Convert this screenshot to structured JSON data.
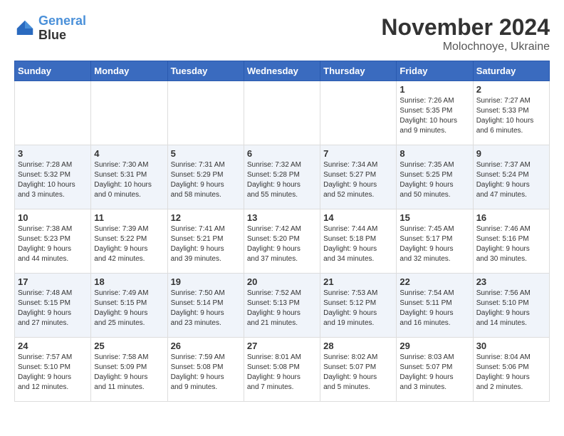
{
  "header": {
    "logo_line1": "General",
    "logo_line2": "Blue",
    "month": "November 2024",
    "location": "Molochnoye, Ukraine"
  },
  "weekdays": [
    "Sunday",
    "Monday",
    "Tuesday",
    "Wednesday",
    "Thursday",
    "Friday",
    "Saturday"
  ],
  "weeks": [
    [
      {
        "day": "",
        "info": ""
      },
      {
        "day": "",
        "info": ""
      },
      {
        "day": "",
        "info": ""
      },
      {
        "day": "",
        "info": ""
      },
      {
        "day": "",
        "info": ""
      },
      {
        "day": "1",
        "info": "Sunrise: 7:26 AM\nSunset: 5:35 PM\nDaylight: 10 hours\nand 9 minutes."
      },
      {
        "day": "2",
        "info": "Sunrise: 7:27 AM\nSunset: 5:33 PM\nDaylight: 10 hours\nand 6 minutes."
      }
    ],
    [
      {
        "day": "3",
        "info": "Sunrise: 7:28 AM\nSunset: 5:32 PM\nDaylight: 10 hours\nand 3 minutes."
      },
      {
        "day": "4",
        "info": "Sunrise: 7:30 AM\nSunset: 5:31 PM\nDaylight: 10 hours\nand 0 minutes."
      },
      {
        "day": "5",
        "info": "Sunrise: 7:31 AM\nSunset: 5:29 PM\nDaylight: 9 hours\nand 58 minutes."
      },
      {
        "day": "6",
        "info": "Sunrise: 7:32 AM\nSunset: 5:28 PM\nDaylight: 9 hours\nand 55 minutes."
      },
      {
        "day": "7",
        "info": "Sunrise: 7:34 AM\nSunset: 5:27 PM\nDaylight: 9 hours\nand 52 minutes."
      },
      {
        "day": "8",
        "info": "Sunrise: 7:35 AM\nSunset: 5:25 PM\nDaylight: 9 hours\nand 50 minutes."
      },
      {
        "day": "9",
        "info": "Sunrise: 7:37 AM\nSunset: 5:24 PM\nDaylight: 9 hours\nand 47 minutes."
      }
    ],
    [
      {
        "day": "10",
        "info": "Sunrise: 7:38 AM\nSunset: 5:23 PM\nDaylight: 9 hours\nand 44 minutes."
      },
      {
        "day": "11",
        "info": "Sunrise: 7:39 AM\nSunset: 5:22 PM\nDaylight: 9 hours\nand 42 minutes."
      },
      {
        "day": "12",
        "info": "Sunrise: 7:41 AM\nSunset: 5:21 PM\nDaylight: 9 hours\nand 39 minutes."
      },
      {
        "day": "13",
        "info": "Sunrise: 7:42 AM\nSunset: 5:20 PM\nDaylight: 9 hours\nand 37 minutes."
      },
      {
        "day": "14",
        "info": "Sunrise: 7:44 AM\nSunset: 5:18 PM\nDaylight: 9 hours\nand 34 minutes."
      },
      {
        "day": "15",
        "info": "Sunrise: 7:45 AM\nSunset: 5:17 PM\nDaylight: 9 hours\nand 32 minutes."
      },
      {
        "day": "16",
        "info": "Sunrise: 7:46 AM\nSunset: 5:16 PM\nDaylight: 9 hours\nand 30 minutes."
      }
    ],
    [
      {
        "day": "17",
        "info": "Sunrise: 7:48 AM\nSunset: 5:15 PM\nDaylight: 9 hours\nand 27 minutes."
      },
      {
        "day": "18",
        "info": "Sunrise: 7:49 AM\nSunset: 5:15 PM\nDaylight: 9 hours\nand 25 minutes."
      },
      {
        "day": "19",
        "info": "Sunrise: 7:50 AM\nSunset: 5:14 PM\nDaylight: 9 hours\nand 23 minutes."
      },
      {
        "day": "20",
        "info": "Sunrise: 7:52 AM\nSunset: 5:13 PM\nDaylight: 9 hours\nand 21 minutes."
      },
      {
        "day": "21",
        "info": "Sunrise: 7:53 AM\nSunset: 5:12 PM\nDaylight: 9 hours\nand 19 minutes."
      },
      {
        "day": "22",
        "info": "Sunrise: 7:54 AM\nSunset: 5:11 PM\nDaylight: 9 hours\nand 16 minutes."
      },
      {
        "day": "23",
        "info": "Sunrise: 7:56 AM\nSunset: 5:10 PM\nDaylight: 9 hours\nand 14 minutes."
      }
    ],
    [
      {
        "day": "24",
        "info": "Sunrise: 7:57 AM\nSunset: 5:10 PM\nDaylight: 9 hours\nand 12 minutes."
      },
      {
        "day": "25",
        "info": "Sunrise: 7:58 AM\nSunset: 5:09 PM\nDaylight: 9 hours\nand 11 minutes."
      },
      {
        "day": "26",
        "info": "Sunrise: 7:59 AM\nSunset: 5:08 PM\nDaylight: 9 hours\nand 9 minutes."
      },
      {
        "day": "27",
        "info": "Sunrise: 8:01 AM\nSunset: 5:08 PM\nDaylight: 9 hours\nand 7 minutes."
      },
      {
        "day": "28",
        "info": "Sunrise: 8:02 AM\nSunset: 5:07 PM\nDaylight: 9 hours\nand 5 minutes."
      },
      {
        "day": "29",
        "info": "Sunrise: 8:03 AM\nSunset: 5:07 PM\nDaylight: 9 hours\nand 3 minutes."
      },
      {
        "day": "30",
        "info": "Sunrise: 8:04 AM\nSunset: 5:06 PM\nDaylight: 9 hours\nand 2 minutes."
      }
    ]
  ]
}
